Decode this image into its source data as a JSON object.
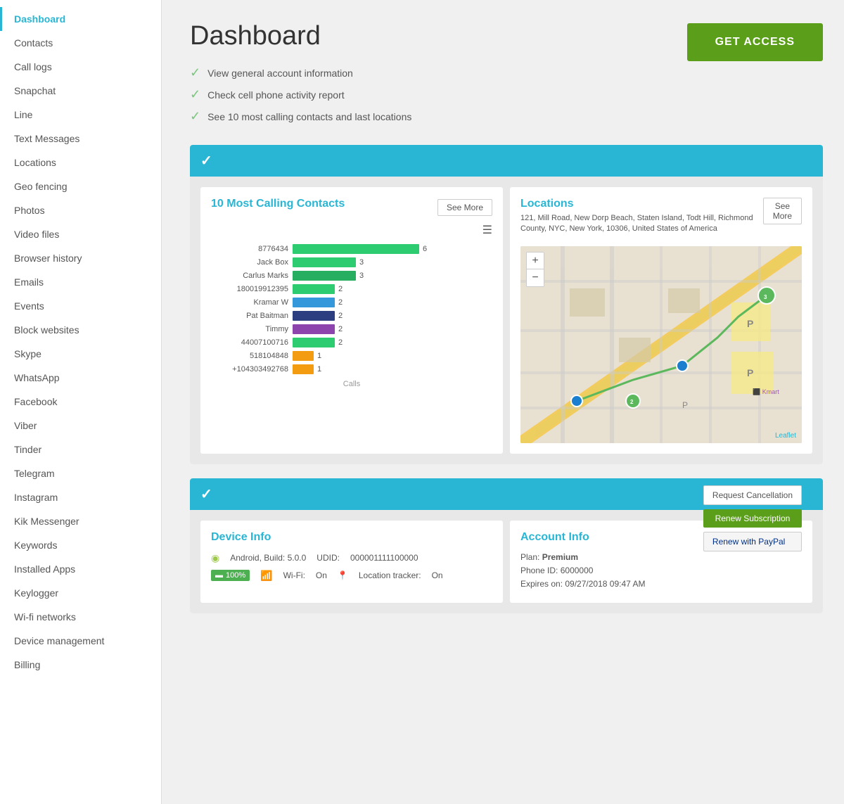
{
  "sidebar": {
    "items": [
      {
        "label": "Dashboard",
        "active": true
      },
      {
        "label": "Contacts",
        "active": false
      },
      {
        "label": "Call logs",
        "active": false
      },
      {
        "label": "Snapchat",
        "active": false
      },
      {
        "label": "Line",
        "active": false
      },
      {
        "label": "Text Messages",
        "active": false
      },
      {
        "label": "Locations",
        "active": false
      },
      {
        "label": "Geo fencing",
        "active": false
      },
      {
        "label": "Photos",
        "active": false
      },
      {
        "label": "Video files",
        "active": false
      },
      {
        "label": "Browser history",
        "active": false
      },
      {
        "label": "Emails",
        "active": false
      },
      {
        "label": "Events",
        "active": false
      },
      {
        "label": "Block websites",
        "active": false
      },
      {
        "label": "Skype",
        "active": false
      },
      {
        "label": "WhatsApp",
        "active": false
      },
      {
        "label": "Facebook",
        "active": false
      },
      {
        "label": "Viber",
        "active": false
      },
      {
        "label": "Tinder",
        "active": false
      },
      {
        "label": "Telegram",
        "active": false
      },
      {
        "label": "Instagram",
        "active": false
      },
      {
        "label": "Kik Messenger",
        "active": false
      },
      {
        "label": "Keywords",
        "active": false
      },
      {
        "label": "Installed Apps",
        "active": false
      },
      {
        "label": "Keylogger",
        "active": false
      },
      {
        "label": "Wi-fi networks",
        "active": false
      },
      {
        "label": "Device management",
        "active": false
      },
      {
        "label": "Billing",
        "active": false
      }
    ]
  },
  "main": {
    "title": "Dashboard",
    "features": [
      {
        "text": "View general account information"
      },
      {
        "text": "Check cell phone activity report"
      },
      {
        "text": "See 10 most calling contacts and last locations"
      }
    ],
    "get_access_label": "GET ACCESS"
  },
  "calling_contacts": {
    "title": "10 Most Calling Contacts",
    "see_more": "See More",
    "bars": [
      {
        "label": "8776434",
        "value": 6,
        "color": "#2ecc71",
        "max": 6
      },
      {
        "label": "Jack Box",
        "value": 3,
        "color": "#2ecc71",
        "max": 6
      },
      {
        "label": "Carlus Marks",
        "value": 3,
        "color": "#27ae60",
        "max": 6
      },
      {
        "label": "180019912395",
        "value": 2,
        "color": "#2ecc71",
        "max": 6
      },
      {
        "label": "Kramar W",
        "value": 2,
        "color": "#3498db",
        "max": 6
      },
      {
        "label": "Pat Baitman",
        "value": 2,
        "color": "#2c3e80",
        "max": 6
      },
      {
        "label": "Timmy",
        "value": 2,
        "color": "#8e44ad",
        "max": 6
      },
      {
        "label": "44007100716",
        "value": 2,
        "color": "#2ecc71",
        "max": 6
      },
      {
        "label": "518104848",
        "value": 1,
        "color": "#f39c12",
        "max": 6
      },
      {
        "label": "+104303492768",
        "value": 1,
        "color": "#f39c12",
        "max": 6
      }
    ],
    "axis_label": "Calls"
  },
  "locations": {
    "title": "Locations",
    "address": "121, Mill Road, New Dorp Beach, Staten Island, Todt Hill, Richmond County, NYC, New York, 10306, United States of America",
    "see_more": "See More",
    "leaflet": "Leaflet"
  },
  "device_info": {
    "title": "Device Info",
    "os": "Android, Build: 5.0.0",
    "udid_label": "UDID:",
    "udid": "000001111100000",
    "battery": "100%",
    "wifi_label": "Wi-Fi:",
    "wifi_status": "On",
    "location_label": "Location tracker:",
    "location_status": "On"
  },
  "account_info": {
    "title": "Account Info",
    "plan_label": "Plan:",
    "plan": "Premium",
    "phone_id_label": "Phone ID:",
    "phone_id": "6000000",
    "expires_label": "Expires on:",
    "expires": "09/27/2018 09:47 AM",
    "btn_cancel": "Request Cancellation",
    "btn_renew": "Renew Subscription",
    "btn_paypal": "Renew with PayPal"
  }
}
